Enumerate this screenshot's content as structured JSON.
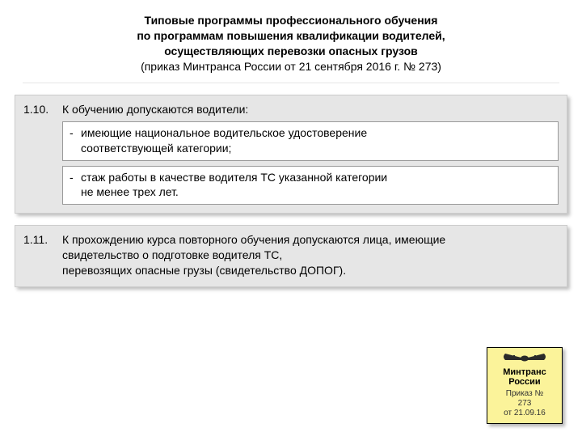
{
  "title": {
    "line1": "Типовые программы профессионального обучения",
    "line2": "по программам повышения квалификации водителей,",
    "line3": "осуществляющих перевозки опасных грузов",
    "subtitle": "(приказ Минтранса России от 21 сентября 2016 г. № 273)"
  },
  "section_110": {
    "number": "1.10.",
    "heading": "К обучению допускаются водители:",
    "item1_line1": "имеющие национальное водительское удостоверение",
    "item1_line2": "соответствующей категории;",
    "item2_line1": "стаж работы в качестве водителя ТС указанной категории",
    "item2_line2": "не менее трех лет."
  },
  "section_111": {
    "number": "1.11.",
    "line1": "К прохождению курса повторного обучения допускаются лица, имеющие",
    "line2": "свидетельство о подготовке водителя ТС,",
    "line3": "перевозящих опасные грузы (свидетельство ДОПОГ)."
  },
  "badge": {
    "org_line1": "Минтранс",
    "org_line2": "России",
    "order_line1": "Приказ №",
    "order_line2": "273",
    "order_line3": "от 21.09.16"
  },
  "dash": "-"
}
